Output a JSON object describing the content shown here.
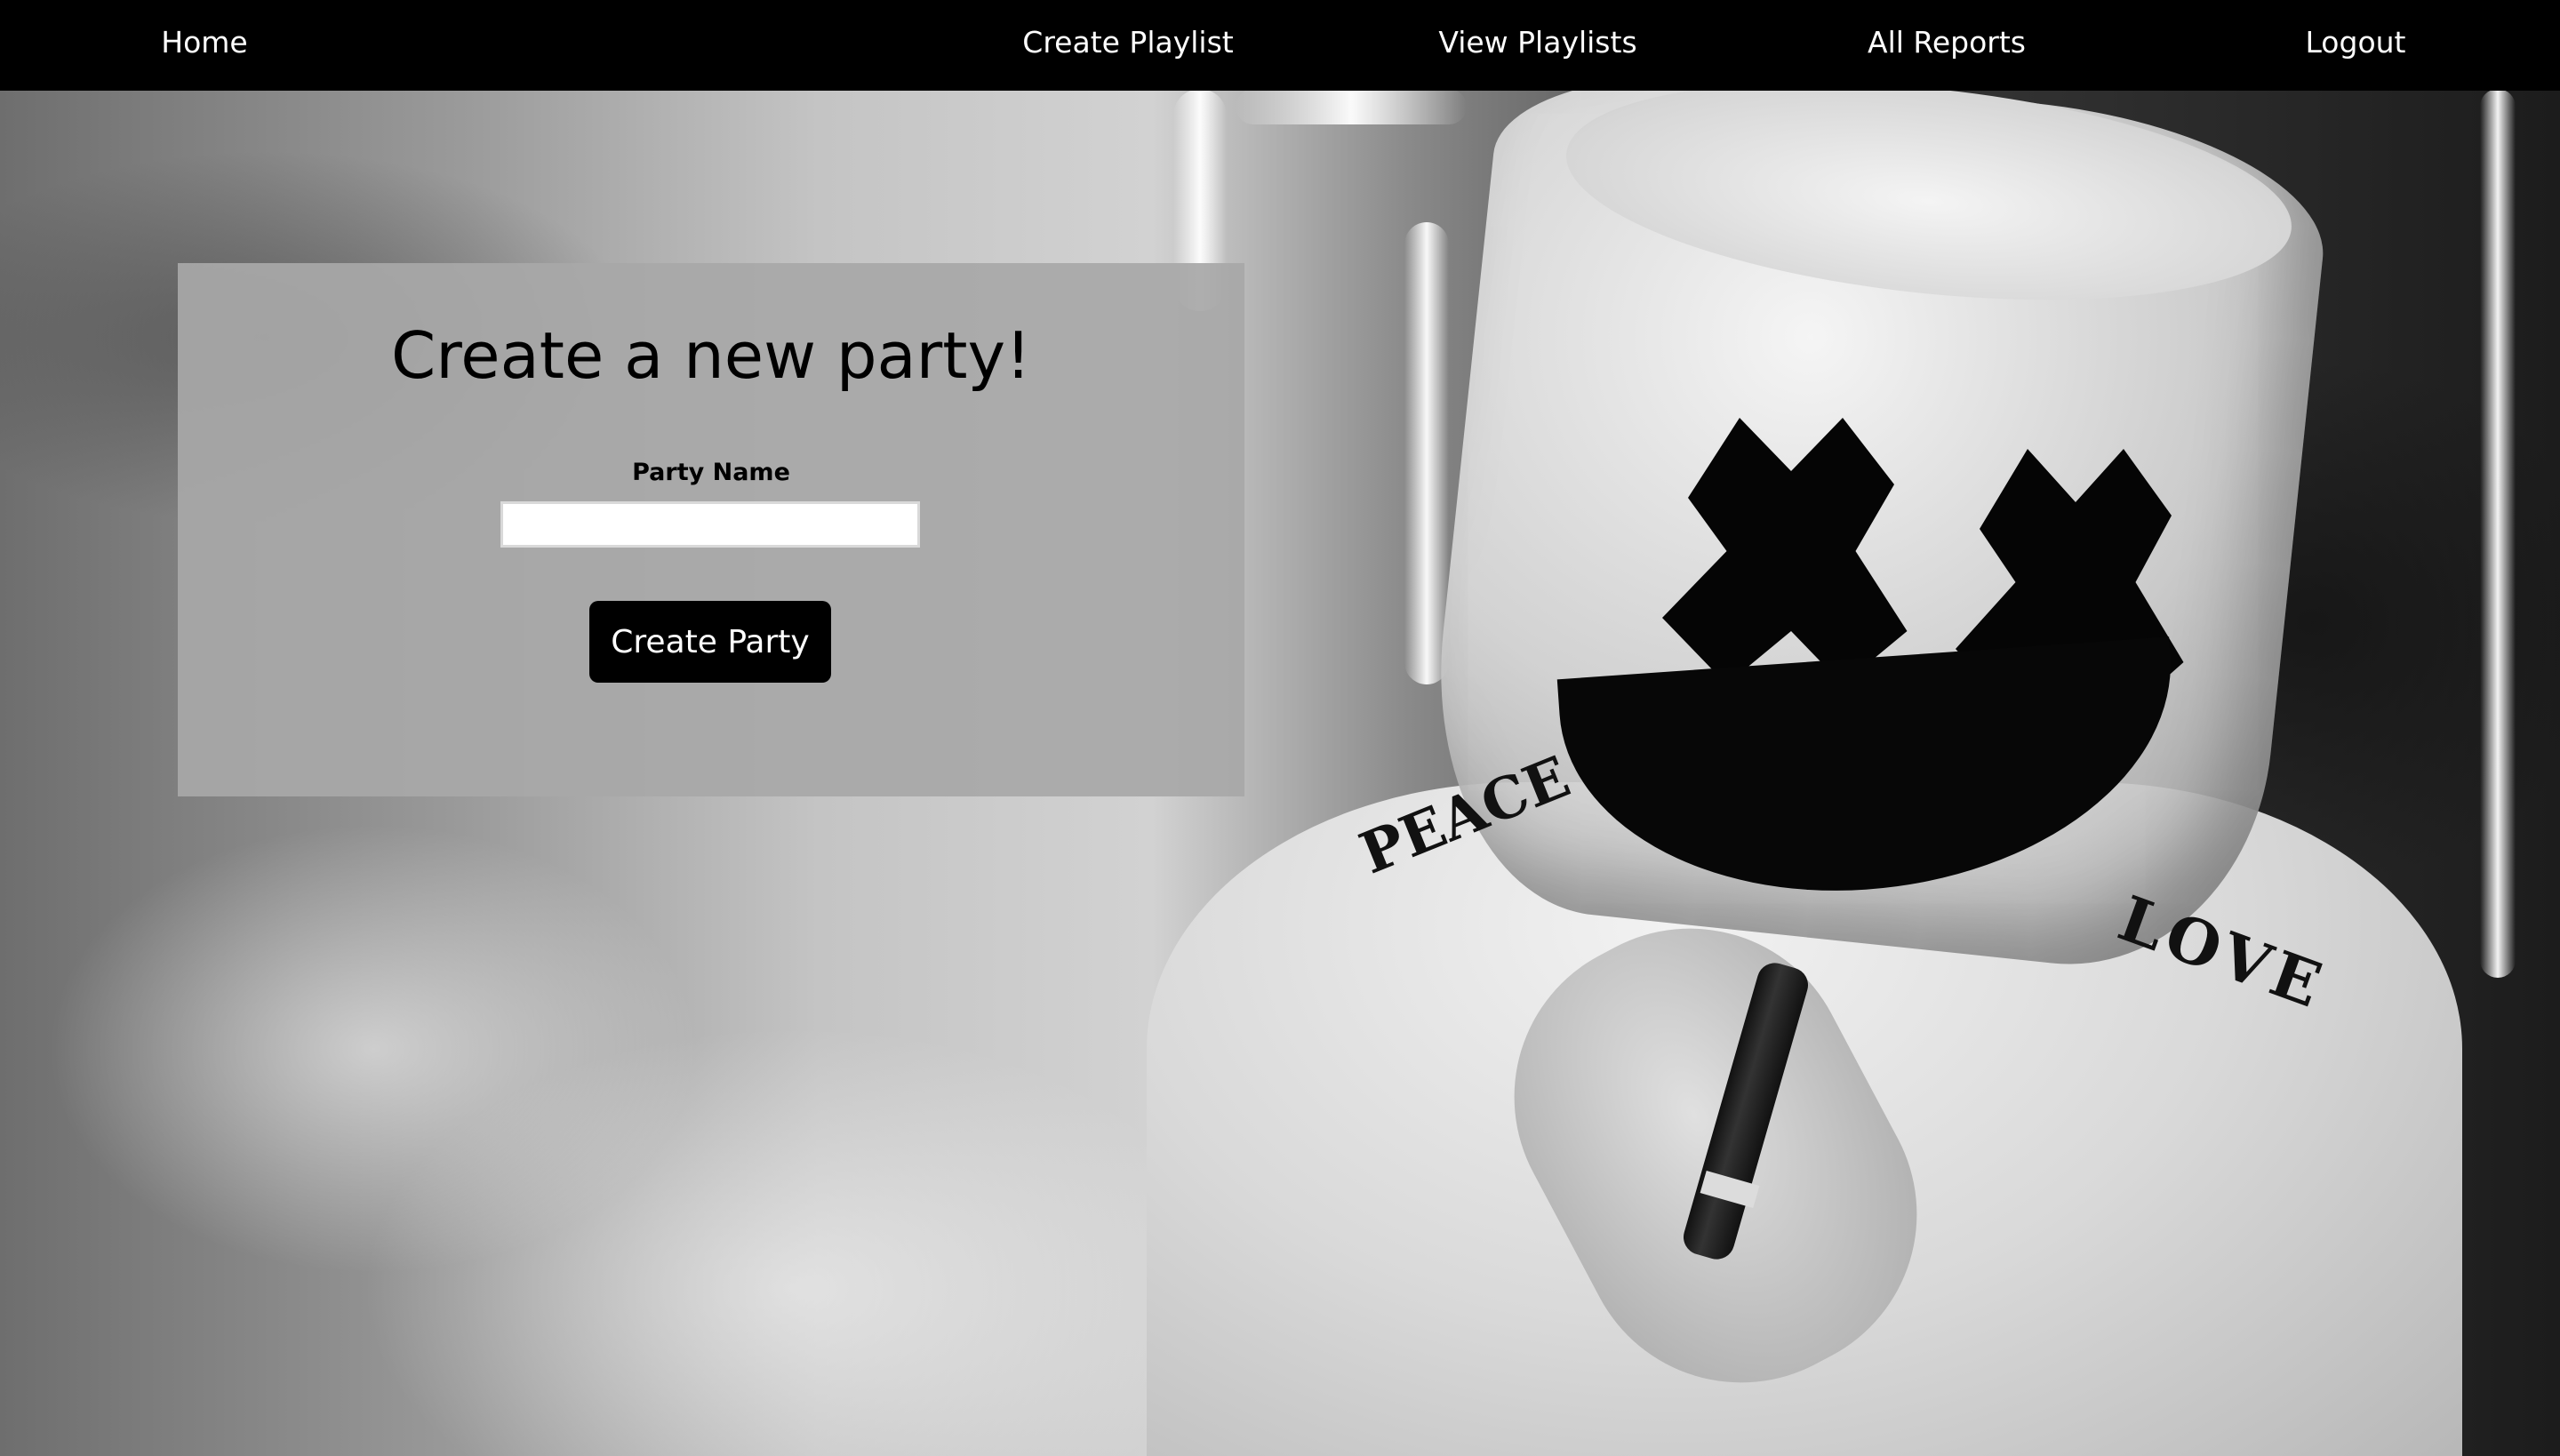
{
  "nav": {
    "home": "Home",
    "create_playlist": "Create Playlist",
    "view_playlists": "View Playlists",
    "all_reports": "All Reports",
    "logout": "Logout"
  },
  "form": {
    "title": "Create a new party!",
    "party_name_label": "Party Name",
    "party_name_value": "",
    "party_name_placeholder": "",
    "submit_label": "Create Party"
  },
  "background": {
    "jacket_text_left": "PEACE",
    "jacket_text_right": "LOVE"
  },
  "colors": {
    "navbar": "#000000",
    "nav_text": "#ffffff",
    "card": "#a8a8a8",
    "button": "#000000",
    "button_text": "#ffffff"
  }
}
